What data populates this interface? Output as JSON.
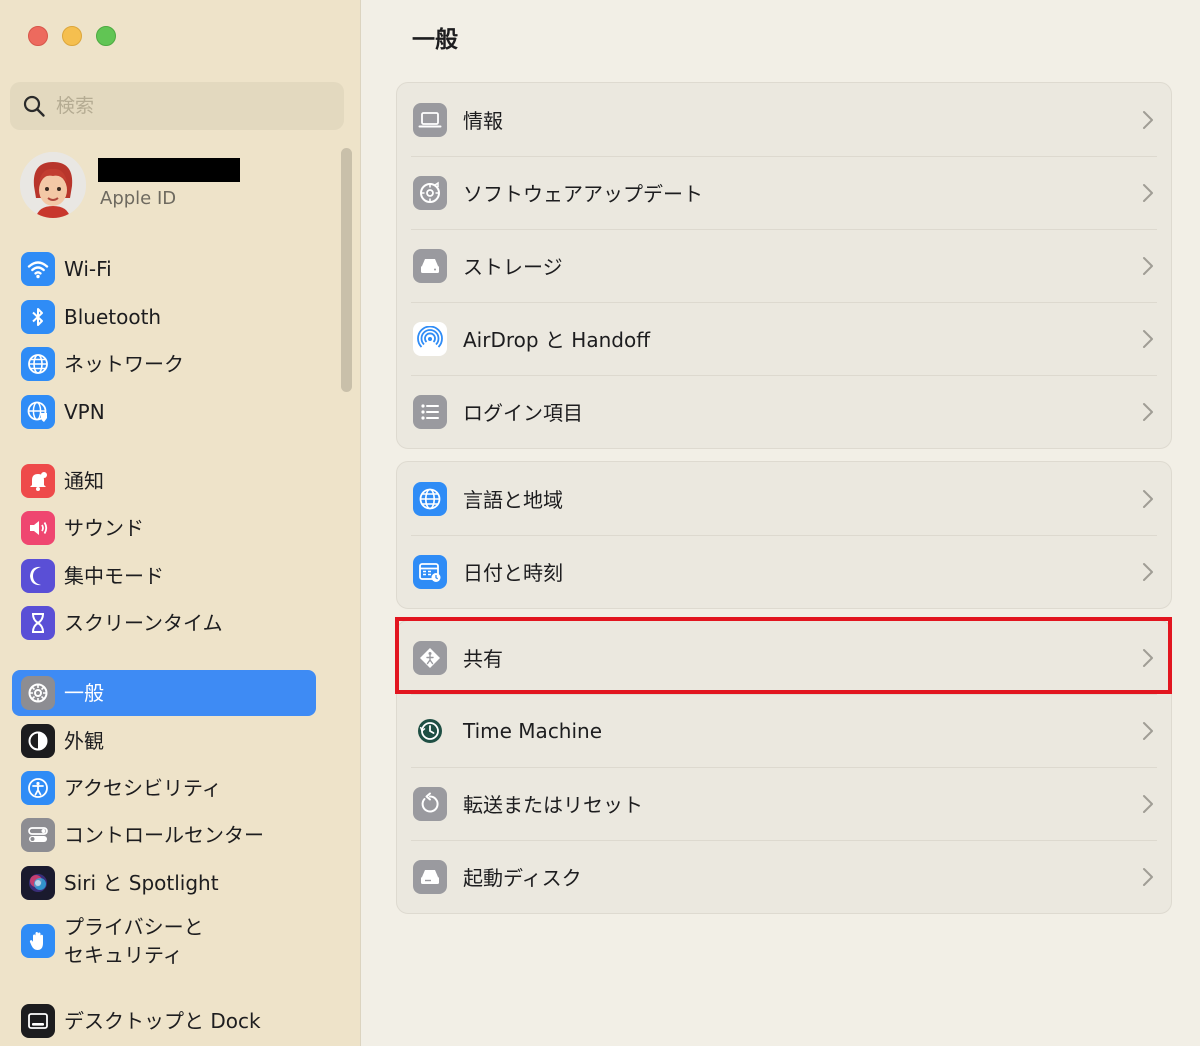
{
  "window": {
    "title": "一般"
  },
  "colors": {
    "accent": "#3e8bf4",
    "highlight": "#e2151f",
    "sidebar_bg": "#eee3c9",
    "main_bg": "#f2efe6"
  },
  "search": {
    "placeholder": "検索",
    "value": ""
  },
  "profile": {
    "subtitle": "Apple ID"
  },
  "sidebar": {
    "items": [
      {
        "label": "Wi-Fi",
        "icon": "wifi-icon"
      },
      {
        "label": "Bluetooth",
        "icon": "bluetooth-icon"
      },
      {
        "label": "ネットワーク",
        "icon": "globe-icon"
      },
      {
        "label": "VPN",
        "icon": "vpn-icon"
      },
      {
        "label": "通知",
        "icon": "bell-icon"
      },
      {
        "label": "サウンド",
        "icon": "speaker-icon"
      },
      {
        "label": "集中モード",
        "icon": "moon-icon"
      },
      {
        "label": "スクリーンタイム",
        "icon": "hourglass-icon"
      },
      {
        "label": "一般",
        "icon": "gear-icon",
        "selected": true
      },
      {
        "label": "外観",
        "icon": "appearance-icon"
      },
      {
        "label": "アクセシビリティ",
        "icon": "accessibility-icon"
      },
      {
        "label": "コントロールセンター",
        "icon": "toggles-icon"
      },
      {
        "label": "Siri と Spotlight",
        "icon": "siri-icon"
      },
      {
        "label": "プライバシーと\nセキュリティ",
        "icon": "hand-icon"
      },
      {
        "label": "デスクトップと Dock",
        "icon": "desktop-icon"
      }
    ]
  },
  "main": {
    "groups": [
      {
        "rows": [
          {
            "label": "情報",
            "icon": "laptop-icon"
          },
          {
            "label": "ソフトウェアアップデート",
            "icon": "update-gear-icon"
          },
          {
            "label": "ストレージ",
            "icon": "drive-icon"
          },
          {
            "label": "AirDrop と Handoff",
            "icon": "airdrop-icon"
          },
          {
            "label": "ログイン項目",
            "icon": "list-icon"
          }
        ]
      },
      {
        "rows": [
          {
            "label": "言語と地域",
            "icon": "globe-icon"
          },
          {
            "label": "日付と時刻",
            "icon": "calendar-clock-icon"
          }
        ]
      },
      {
        "rows": [
          {
            "label": "共有",
            "icon": "sharing-icon",
            "highlighted": true
          },
          {
            "label": "Time Machine",
            "icon": "time-machine-icon"
          },
          {
            "label": "転送またはリセット",
            "icon": "reset-icon"
          },
          {
            "label": "起動ディスク",
            "icon": "disk-icon"
          }
        ]
      }
    ]
  }
}
